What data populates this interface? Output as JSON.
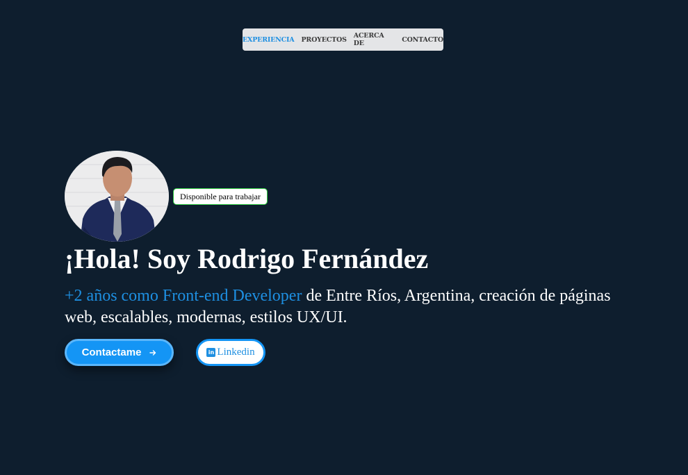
{
  "nav": {
    "items": [
      {
        "label": "EXPERIENCIA",
        "active": true
      },
      {
        "label": "PROYECTOS",
        "active": false
      },
      {
        "label": "ACERCA DE",
        "active": false
      },
      {
        "label": "CONTACTO",
        "active": false
      }
    ]
  },
  "hero": {
    "avatar_icon": "profile-photo",
    "badge": "Disponible para trabajar",
    "title": "¡Hola! Soy Rodrigo Fernández",
    "subtitle_highlight": "+2 años como Front-end Developer",
    "subtitle_rest": " de Entre Ríos, Argentina, creación de páginas web, escalables, modernas, estilos UX/UI.",
    "contact_button": "Contactame",
    "contact_icon": "arrow-right-icon",
    "linkedin_button": "Linkedin",
    "linkedin_icon": "linkedin-icon"
  },
  "colors": {
    "background": "#0e1e2e",
    "accent": "#1e8fe1",
    "button": "#1495f5",
    "badge_border": "#2ecc40"
  }
}
